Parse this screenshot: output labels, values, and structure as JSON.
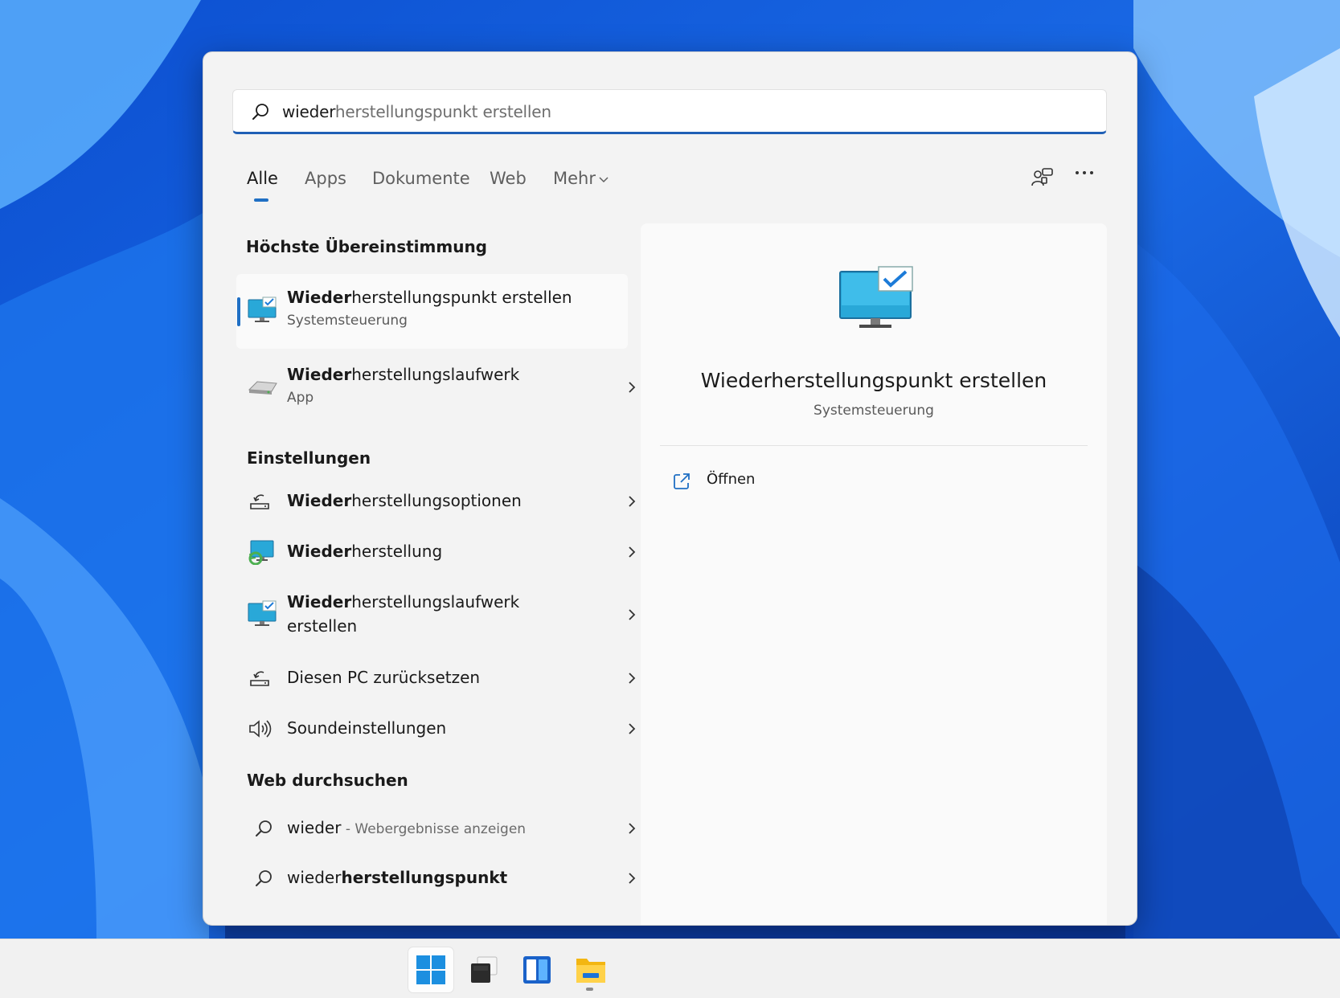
{
  "search": {
    "typed": "wieder",
    "suggestion_rest": "herstellungspunkt erstellen"
  },
  "tabs": [
    {
      "label": "Alle"
    },
    {
      "label": "Apps"
    },
    {
      "label": "Dokumente"
    },
    {
      "label": "Web"
    },
    {
      "label": "Mehr"
    }
  ],
  "sections": {
    "best_match": "Höchste Übereinstimmung",
    "settings": "Einstellungen",
    "web": "Web durchsuchen"
  },
  "best_match": {
    "bold": "Wieder",
    "rest": "herstellungspunkt erstellen",
    "sub": "Systemsteuerung"
  },
  "apps": [
    {
      "bold": "Wieder",
      "rest": "herstellungslaufwerk",
      "sub": "App",
      "icon": "drive-icon"
    }
  ],
  "settings": [
    {
      "bold": "Wieder",
      "rest": "herstellungsoptionen",
      "icon": "recovery-options-icon"
    },
    {
      "bold": "Wieder",
      "rest": "herstellung",
      "icon": "recovery-monitor-icon"
    },
    {
      "bold": "Wieder",
      "rest": "herstellungslaufwerk",
      "line2": "erstellen",
      "icon": "monitor-check-icon"
    },
    {
      "text": "Diesen PC zurücksetzen",
      "icon": "reset-pc-icon"
    },
    {
      "text": "Soundeinstellungen",
      "icon": "speaker-icon"
    }
  ],
  "web": [
    {
      "normal": "wieder",
      "sep": " - ",
      "hint": "Webergebnisse anzeigen"
    },
    {
      "normal": "wieder",
      "bold": "herstellungspunkt"
    }
  ],
  "preview": {
    "title": "Wiederherstellungspunkt erstellen",
    "subtitle": "Systemsteuerung",
    "actions": [
      {
        "label": "Öffnen",
        "icon": "open-external-icon"
      }
    ]
  },
  "taskbar": {
    "items": [
      "start-icon",
      "task-view-icon",
      "widgets-icon",
      "file-explorer-icon"
    ]
  },
  "colors": {
    "accent": "#1f6fc4",
    "panel": "#f3f3f3",
    "wallpaper": "#1b62d8"
  }
}
